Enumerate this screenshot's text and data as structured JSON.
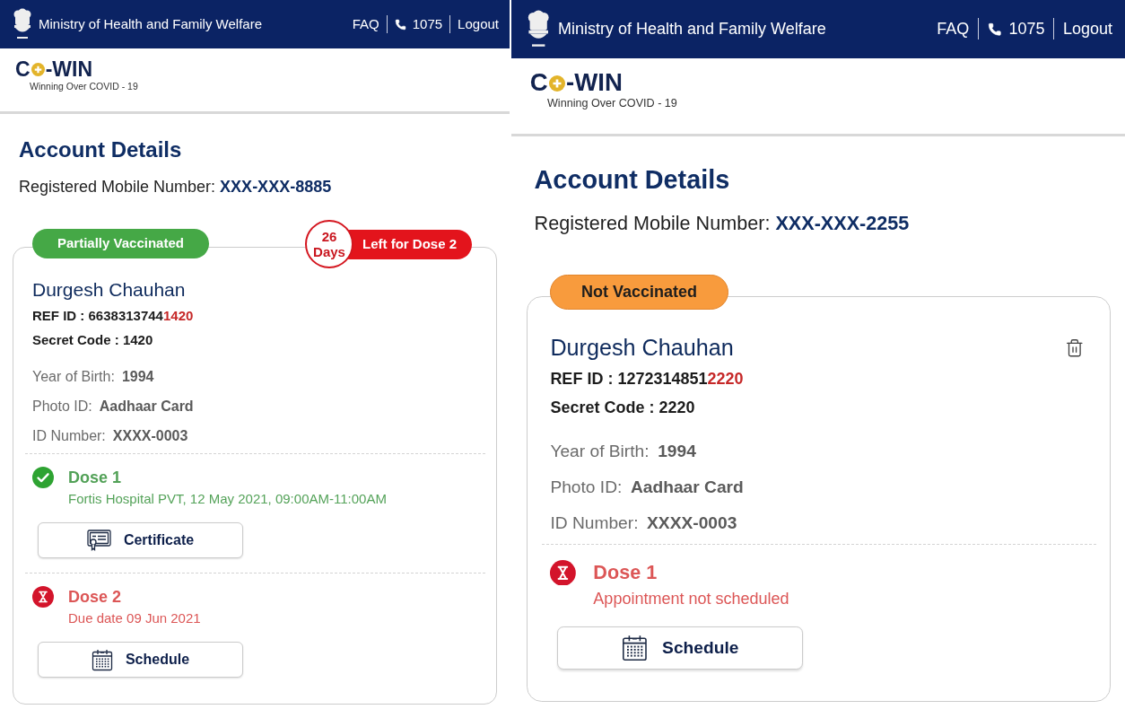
{
  "panels": [
    {
      "header": {
        "title": "Ministry of Health and Family Welfare",
        "links": [
          {
            "kind": "text",
            "label": "FAQ"
          },
          {
            "kind": "phone",
            "label": "1075"
          },
          {
            "kind": "text",
            "label": "Logout"
          }
        ]
      },
      "brand": {
        "name_start": "C",
        "name_end": "-WIN",
        "tagline": "Winning Over COVID - 19"
      },
      "account": {
        "title": "Account Details",
        "mobile_label": "Registered Mobile Number:",
        "mobile": "XXX-XXX-8885"
      },
      "beneficiary": {
        "status": {
          "kind": "partial",
          "label": "Partially Vaccinated"
        },
        "countdown": {
          "days": "26",
          "unit": "Days",
          "label": "Left for Dose 2"
        },
        "name": "Durgesh Chauhan",
        "ref_id": {
          "label": "REF ID :",
          "value": "6638313744",
          "highlight": "1420"
        },
        "secret_code": {
          "label": "Secret Code :",
          "value": "1420"
        },
        "details": [
          {
            "label": "Year of Birth:",
            "value": "1994"
          },
          {
            "label": "Photo ID:",
            "value": "Aadhaar Card"
          },
          {
            "label": "ID Number:",
            "value": "XXXX-0003"
          }
        ],
        "doses": [
          {
            "kind": "done",
            "title": "Dose 1",
            "detail": "Fortis Hospital PVT, 12 May 2021, 09:00AM-11:00AM",
            "action": {
              "kind": "certificate",
              "label": "Certificate"
            }
          },
          {
            "kind": "pending",
            "title": "Dose 2",
            "detail": "Due date 09 Jun 2021",
            "action": {
              "kind": "schedule",
              "label": "Schedule"
            }
          }
        ]
      }
    },
    {
      "header": {
        "title": "Ministry of Health and Family Welfare",
        "links": [
          {
            "kind": "text",
            "label": "FAQ"
          },
          {
            "kind": "phone",
            "label": "1075"
          },
          {
            "kind": "text",
            "label": "Logout"
          }
        ]
      },
      "brand": {
        "name_start": "C",
        "name_end": "-WIN",
        "tagline": "Winning Over COVID - 19"
      },
      "account": {
        "title": "Account Details",
        "mobile_label": "Registered Mobile Number:",
        "mobile": "XXX-XXX-2255"
      },
      "beneficiary": {
        "status": {
          "kind": "none",
          "label": "Not Vaccinated"
        },
        "name": "Durgesh Chauhan",
        "deletable": true,
        "ref_id": {
          "label": "REF ID :",
          "value": "1272314851",
          "highlight": "2220"
        },
        "secret_code": {
          "label": "Secret Code :",
          "value": "2220"
        },
        "details": [
          {
            "label": "Year of Birth:",
            "value": "1994"
          },
          {
            "label": "Photo ID:",
            "value": "Aadhaar Card"
          },
          {
            "label": "ID Number:",
            "value": "XXXX-0003"
          }
        ],
        "doses": [
          {
            "kind": "pending",
            "title": "Dose 1",
            "detail": "Appointment not scheduled",
            "action": {
              "kind": "schedule",
              "label": "Schedule"
            }
          }
        ]
      }
    }
  ]
}
